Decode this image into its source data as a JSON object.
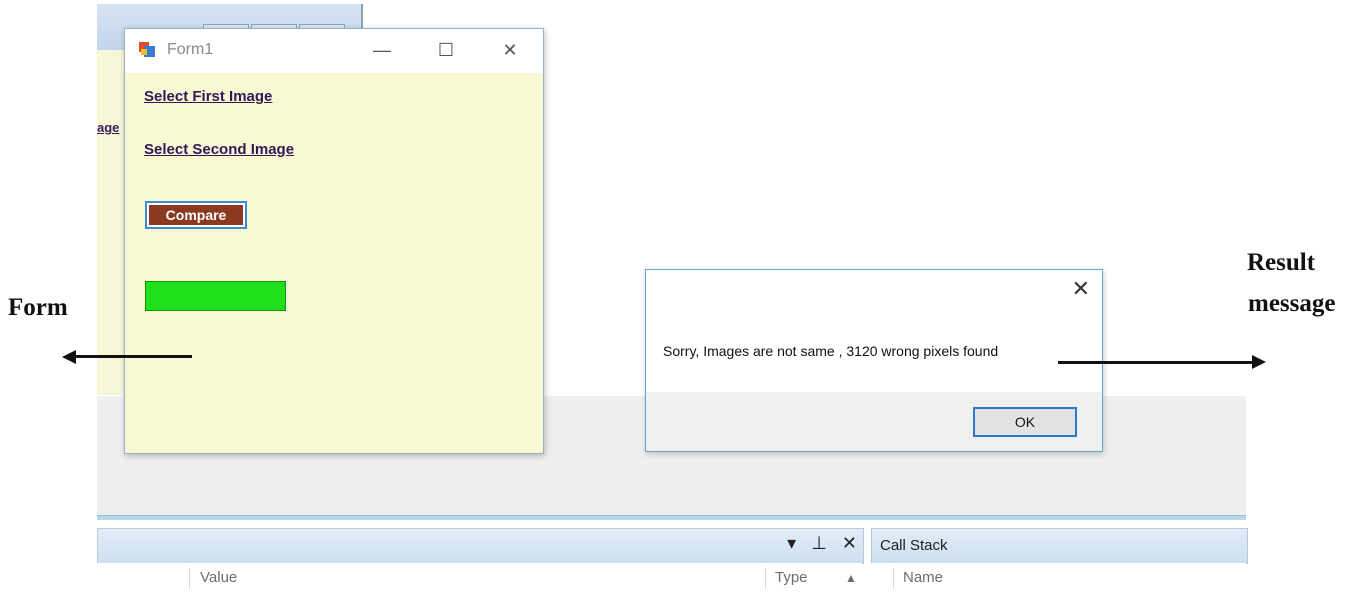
{
  "background_ide": {
    "partial_link_text": "age",
    "locals_panel": {
      "columns": [
        "Value",
        "Type"
      ]
    },
    "callstack_panel": {
      "title": "Call Stack",
      "columns": [
        "Name"
      ]
    },
    "panel_icons": [
      "dropdown-arrow-icon",
      "pin-icon",
      "close-icon"
    ]
  },
  "form": {
    "title": "Form1",
    "links": {
      "first": "Select First Image",
      "second": "Select Second Image"
    },
    "compare_button": "Compare",
    "progress_fraction": 1.0,
    "progress_color": "#1fe01a"
  },
  "message_box": {
    "text": "Sorry, Images are not same , 3120 wrong pixels found",
    "ok_button": "OK",
    "close_icon": "close-icon"
  },
  "annotations": {
    "form": "Form",
    "result_line1": "Result",
    "result_line2": "message"
  },
  "colors": {
    "form_bg": "#f8f8d5",
    "compare_bg": "#8b3a1f",
    "focus_blue": "#2e78c9"
  }
}
